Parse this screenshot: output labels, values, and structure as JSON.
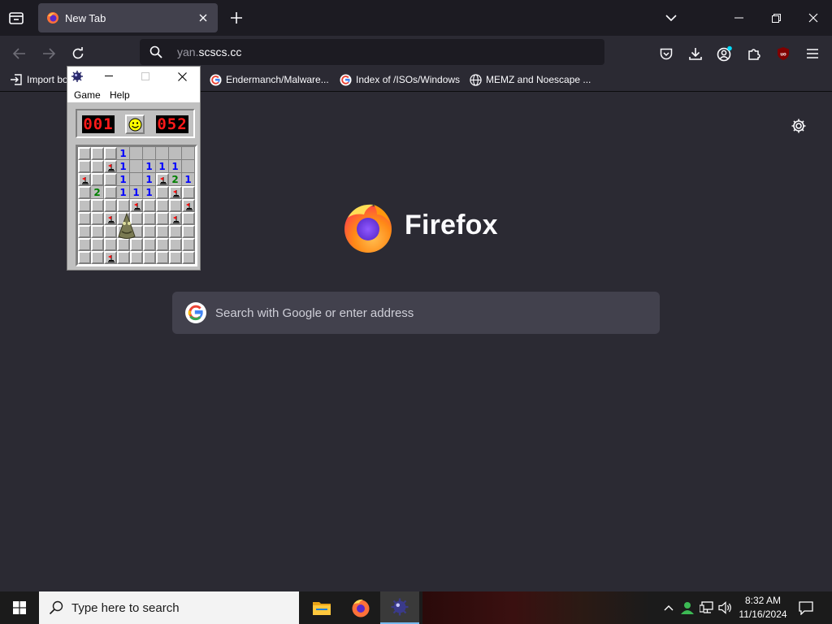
{
  "tab": {
    "title": "New Tab"
  },
  "url": {
    "prefix": "yan.",
    "domain": "scscs.cc"
  },
  "bookmarks": [
    {
      "label": "Import bookmarks..."
    },
    {
      "label": "Endermanch/Malware..."
    },
    {
      "label": "Index of /ISOs/Windows"
    },
    {
      "label": "MEMZ and Noescape ..."
    }
  ],
  "newtab": {
    "brand": "Firefox",
    "search_placeholder": "Search with Google or enter address"
  },
  "minesweeper": {
    "menu": [
      "Game",
      "Help"
    ],
    "mine_counter": "001",
    "timer": "052",
    "rows": [
      "UUU1OOOOO",
      "UUF1O111O",
      "FUU1O1F21",
      "U2U111UFU",
      "UUUUFUUUF",
      "UUFUUUUFU",
      "UUUUUUUUU",
      "UUUUUUUUU",
      "UUFUUUUUU"
    ]
  },
  "taskbar": {
    "search_placeholder": "Type here to search",
    "time": "8:32 AM",
    "date": "11/16/2024"
  }
}
